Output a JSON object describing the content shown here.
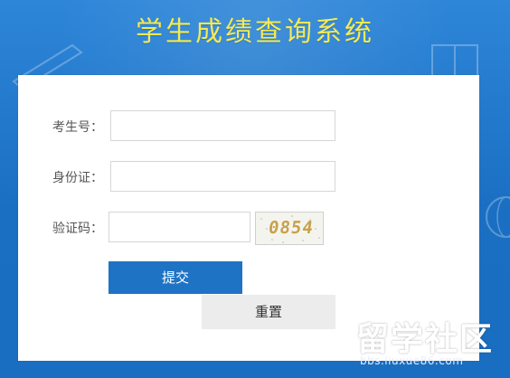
{
  "header": {
    "title": "学生成绩查询系统"
  },
  "form": {
    "exam_no_label": "考生号：",
    "exam_no_value": "",
    "id_card_label": "身份证：",
    "id_card_value": "",
    "captcha_label": "验证码：",
    "captcha_value": "",
    "captcha_image_text": "0854"
  },
  "buttons": {
    "submit": "提交",
    "reset": "重置"
  },
  "watermark": {
    "brand": "留学社区",
    "url": "bbs.liuxue86.com"
  },
  "colors": {
    "background": "#1f78cc",
    "title": "#f3ea55",
    "primary_button": "#1f73c5",
    "secondary_button": "#ececec"
  }
}
